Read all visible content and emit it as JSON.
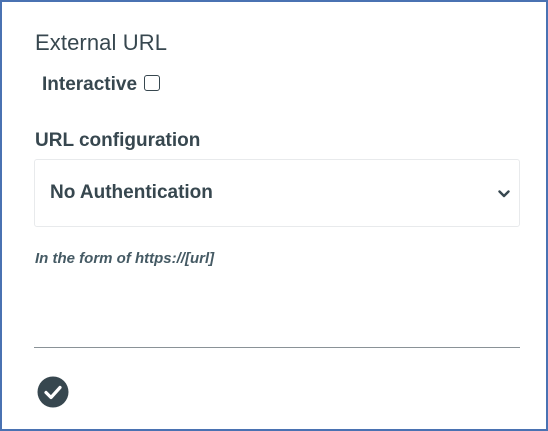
{
  "form": {
    "title": "External URL",
    "interactive_label": "Interactive",
    "interactive_checked": false,
    "url_config_label": "URL configuration",
    "url_config_value": "No Authentication",
    "hint": "In the form of https://[url]"
  },
  "icons": {
    "select_chevron": "chevron-down-icon",
    "confirm": "check-circle-icon"
  },
  "colors": {
    "text": "#37474f",
    "border_accent": "#4a72b2",
    "divider": "#8a9297"
  }
}
